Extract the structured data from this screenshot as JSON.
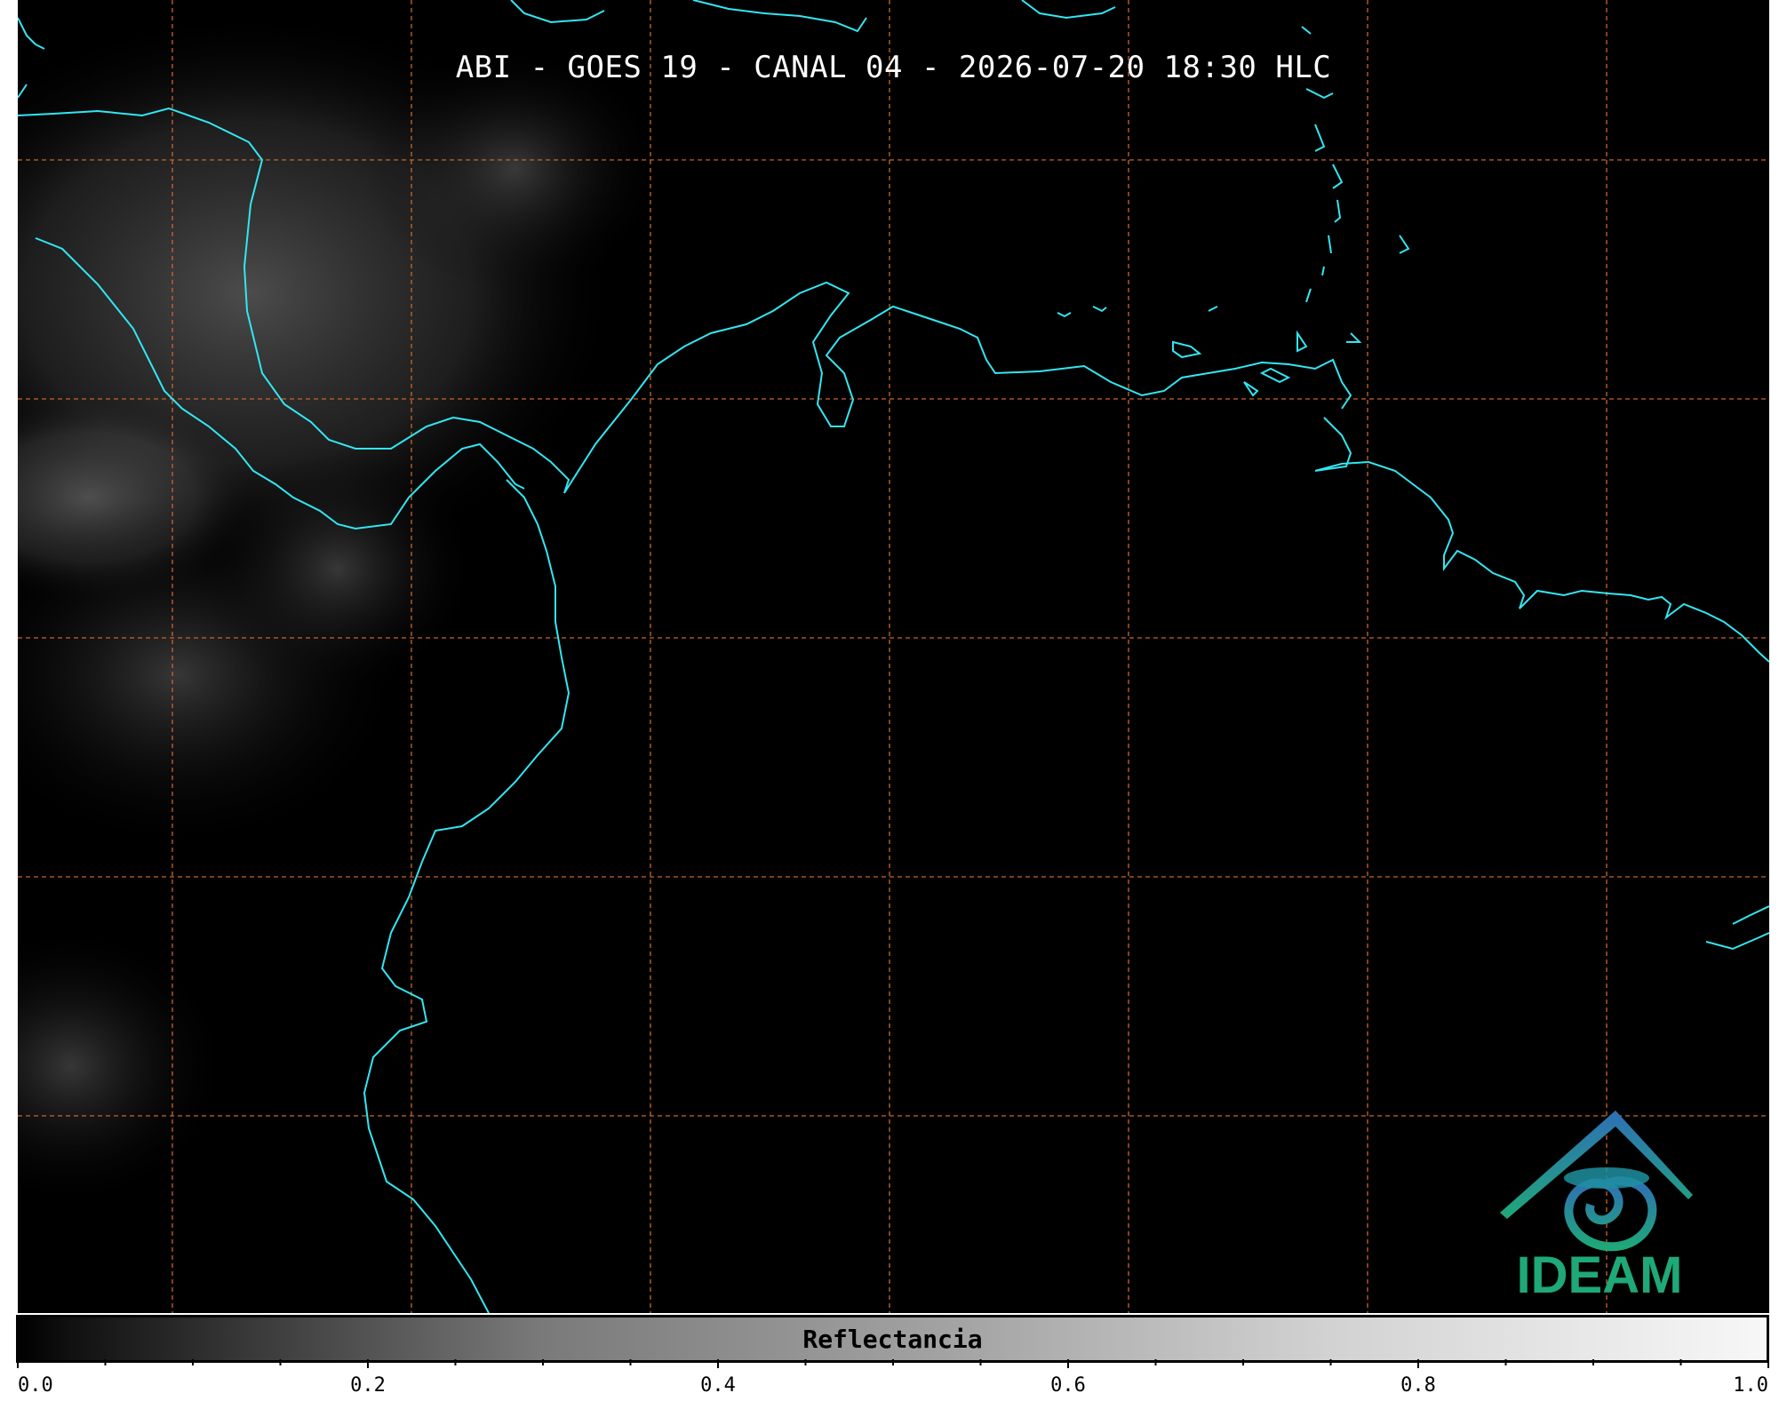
{
  "title": "ABI - GOES 19 - CANAL 04 - 2026-07-20 18:30 HLC",
  "colorbar": {
    "label": "Reflectancia",
    "tick_labels": [
      "0.0",
      "0.2",
      "0.4",
      "0.6",
      "0.8",
      "1.0"
    ],
    "min": 0.0,
    "max": 1.0
  },
  "logo": {
    "text": "IDEAM"
  },
  "colors": {
    "coastline": "#33e6f2",
    "grid": "#c8652a",
    "logo_text": "#1fa878",
    "logo_blue": "#2f6fb5",
    "background": "#000000"
  },
  "map": {
    "grid_style": "dashed",
    "grid_columns": 8,
    "grid_rows": 6
  }
}
